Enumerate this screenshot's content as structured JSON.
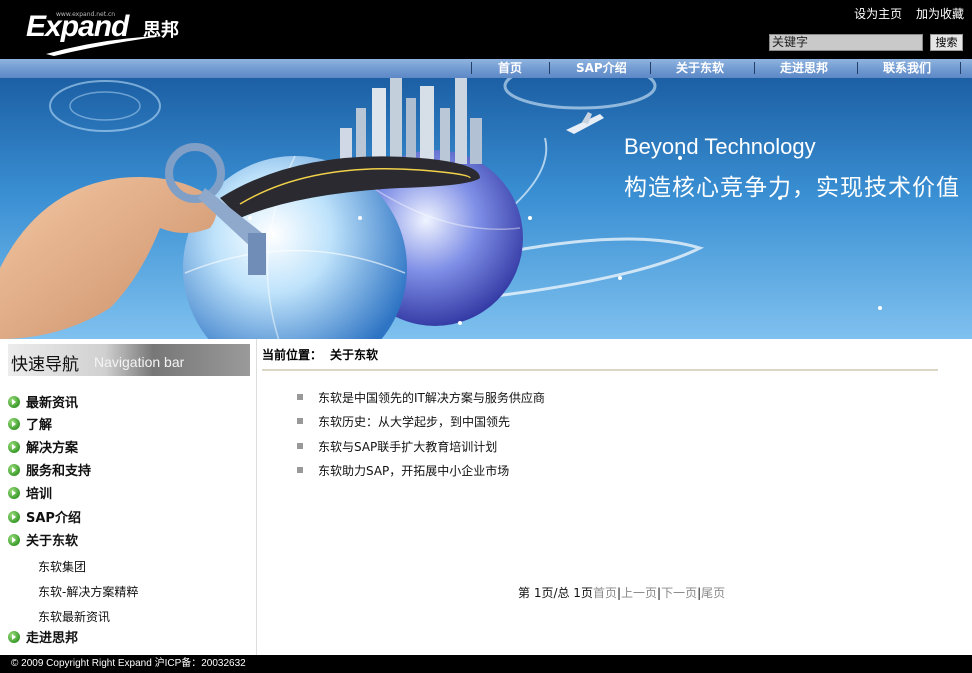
{
  "header": {
    "site_url": "www.expand.net.cn",
    "logo_text": "Expand",
    "logo_cn": "思邦",
    "links": [
      "设为主页",
      "加为收藏"
    ],
    "search_value": "关键字",
    "search_button": "搜索"
  },
  "nav": [
    "首页",
    "SAP介绍",
    "关于东软",
    "走进思邦",
    "联系我们"
  ],
  "banner": {
    "tagline_en": "Beyond Technology",
    "tagline_cn": "构造核心竞争力，实现技术价值"
  },
  "sidebar": {
    "title_cn": "快速导航",
    "title_en": "Navigation bar",
    "items": [
      {
        "label": "最新资讯"
      },
      {
        "label": "了解"
      },
      {
        "label": "解决方案"
      },
      {
        "label": "服务和支持"
      },
      {
        "label": "培训"
      },
      {
        "label": "SAP介绍"
      },
      {
        "label": "关于东软"
      },
      {
        "label": "走进思邦"
      }
    ],
    "subitems": [
      "东软集团",
      "东软-解决方案精粹",
      "东软最新资讯"
    ]
  },
  "breadcrumb": {
    "label": "当前位置：",
    "current": "关于东软"
  },
  "articles": [
    "东软是中国领先的IT解决方案与服务供应商",
    "东软历史：从大学起步，到中国领先",
    "东软与SAP联手扩大教育培训计划",
    "东软助力SAP，开拓展中小企业市场"
  ],
  "pager": {
    "page_info": "第  1页/总 1页",
    "first": "首页",
    "prev": "上一页",
    "next": "下一页",
    "last": "尾页"
  },
  "footer": "© 2009 Copyright Right Expand 沪ICP备：20032632"
}
